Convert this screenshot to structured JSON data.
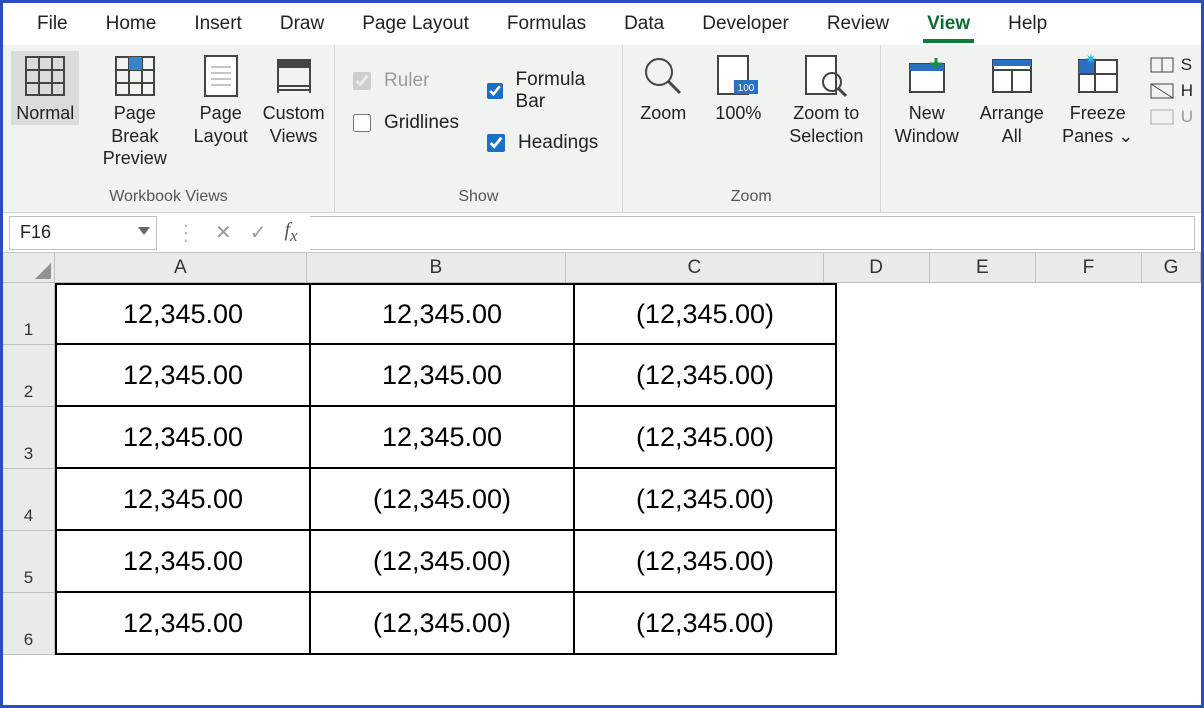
{
  "menu": {
    "tabs": [
      "File",
      "Home",
      "Insert",
      "Draw",
      "Page Layout",
      "Formulas",
      "Data",
      "Developer",
      "Review",
      "View",
      "Help"
    ],
    "active": "View"
  },
  "ribbon": {
    "workbook_views": {
      "label": "Workbook Views",
      "normal": "Normal",
      "page_break": "Page Break Preview",
      "page_layout": "Page Layout",
      "custom": "Custom Views"
    },
    "show": {
      "label": "Show",
      "ruler": "Ruler",
      "ruler_checked": true,
      "formula_bar": "Formula Bar",
      "formula_bar_checked": true,
      "gridlines": "Gridlines",
      "gridlines_checked": false,
      "headings": "Headings",
      "headings_checked": true
    },
    "zoom": {
      "label": "Zoom",
      "zoom": "Zoom",
      "hundred": "100%",
      "to_selection": "Zoom to Selection"
    },
    "window": {
      "new_window": "New Window",
      "arrange_all": "Arrange All",
      "freeze": "Freeze Panes ⌄",
      "split": "S",
      "hide": "H",
      "unhide": "U"
    }
  },
  "namebox": "F16",
  "columns": [
    "A",
    "B",
    "C",
    "D",
    "E",
    "F",
    "G"
  ],
  "rows": [
    "1",
    "2",
    "3",
    "4",
    "5",
    "6"
  ],
  "cells": {
    "A": [
      "12,345.00",
      "12,345.00",
      "12,345.00",
      "12,345.00",
      "12,345.00",
      "12,345.00"
    ],
    "B": [
      "12,345.00",
      "12,345.00",
      "12,345.00",
      "(12,345.00)",
      "(12,345.00)",
      "(12,345.00)"
    ],
    "C": [
      "(12,345.00)",
      "(12,345.00)",
      "(12,345.00)",
      "(12,345.00)",
      "(12,345.00)",
      "(12,345.00)"
    ]
  }
}
